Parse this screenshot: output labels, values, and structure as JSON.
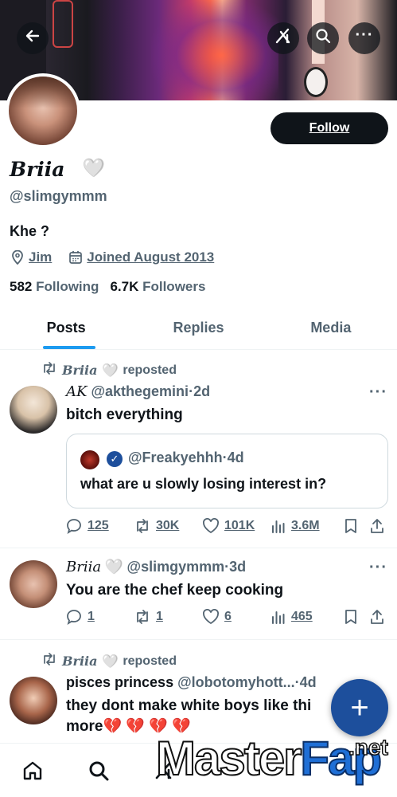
{
  "banner": {
    "back_icon": "back-arrow-icon",
    "grok_icon": "grok-icon",
    "search_icon": "search-icon",
    "more_icon": "more-icon"
  },
  "profile": {
    "display_name": "Briia",
    "name_emoji": "🤍",
    "handle": "@slimgymmm",
    "bio": "Khe ?",
    "location": "Jim",
    "joined": "Joined August 2013",
    "following_count": "582",
    "following_label": "Following",
    "followers_count": "6.7K",
    "followers_label": "Followers",
    "follow_button": "Follow"
  },
  "tabs": [
    {
      "label": "Posts",
      "active": true
    },
    {
      "label": "Replies",
      "active": false
    },
    {
      "label": "Media",
      "active": false
    }
  ],
  "posts": [
    {
      "repost_by": "Briia",
      "repost_emoji": "🤍",
      "repost_label": "reposted",
      "author_name": "AK",
      "handle": "@akthegemini",
      "time": "2d",
      "text": "bitch everything",
      "quote": {
        "handle": "@Freakyehhh",
        "time": "4d",
        "text": "what are u slowly losing interest in?"
      },
      "replies": "125",
      "reposts": "30K",
      "likes": "101K",
      "views": "3.6M"
    },
    {
      "author_name": "Briia",
      "name_emoji": "🤍",
      "handle": "@slimgymmm",
      "time": "3d",
      "text": "You are the chef keep cooking",
      "replies": "1",
      "reposts": "1",
      "likes": "6",
      "views": "465"
    },
    {
      "repost_by": "Briia",
      "repost_emoji": "🤍",
      "repost_label": "reposted",
      "author_name": "pisces princess",
      "handle": "@lobotomyhott...",
      "time": "4d",
      "text_line1": "they dont make white boys like thi",
      "text_line2": "more💔 💔 💔 💔"
    }
  ],
  "fab": {
    "label": "+"
  },
  "watermark": {
    "text_a": "Master",
    "text_b": "Fap",
    "text_c": ".net"
  },
  "colors": {
    "accent": "#1d9bf0",
    "fab": "#1d4f9c",
    "muted": "#536471",
    "text": "#0f1419"
  }
}
